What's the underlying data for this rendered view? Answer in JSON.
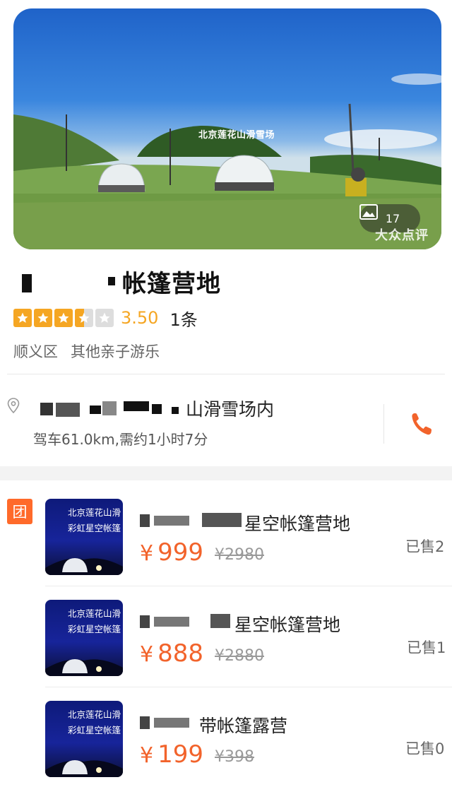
{
  "hero": {
    "sign_text": "北京莲花山滑雪场",
    "photo_count": "17",
    "watermark": "大众点评"
  },
  "poi": {
    "title_visible": "帐篷营地",
    "rating": "3.50",
    "stars": 3.5,
    "review_count": "1条",
    "district": "顺义区",
    "category": "其他亲子游乐",
    "address_visible": "山滑雪场内",
    "drive_info": "驾车61.0km,需约1小时7分"
  },
  "deals_badge": "团",
  "deals": [
    {
      "thumb_line1": "北京莲花山滑",
      "thumb_line2": "彩虹星空帐篷",
      "name_visible": "星空帐篷营地",
      "price": "999",
      "original_price": "¥2980",
      "sold": "已售2"
    },
    {
      "thumb_line1": "北京莲花山滑",
      "thumb_line2": "彩虹星空帐篷",
      "name_visible": "星空帐篷营地",
      "price": "888",
      "original_price": "¥2880",
      "sold": "已售1"
    },
    {
      "thumb_line1": "北京莲花山滑",
      "thumb_line2": "彩虹星空帐篷",
      "name_visible": "带帐篷露营",
      "price": "199",
      "original_price": "¥398",
      "sold": "已售0"
    }
  ],
  "currency_symbol": "¥",
  "colors": {
    "accent_orange": "#f2632b",
    "star_gold": "#f5a623"
  },
  "icons": {
    "photo": "image-icon",
    "location": "location-pin-icon",
    "call": "phone-icon"
  }
}
